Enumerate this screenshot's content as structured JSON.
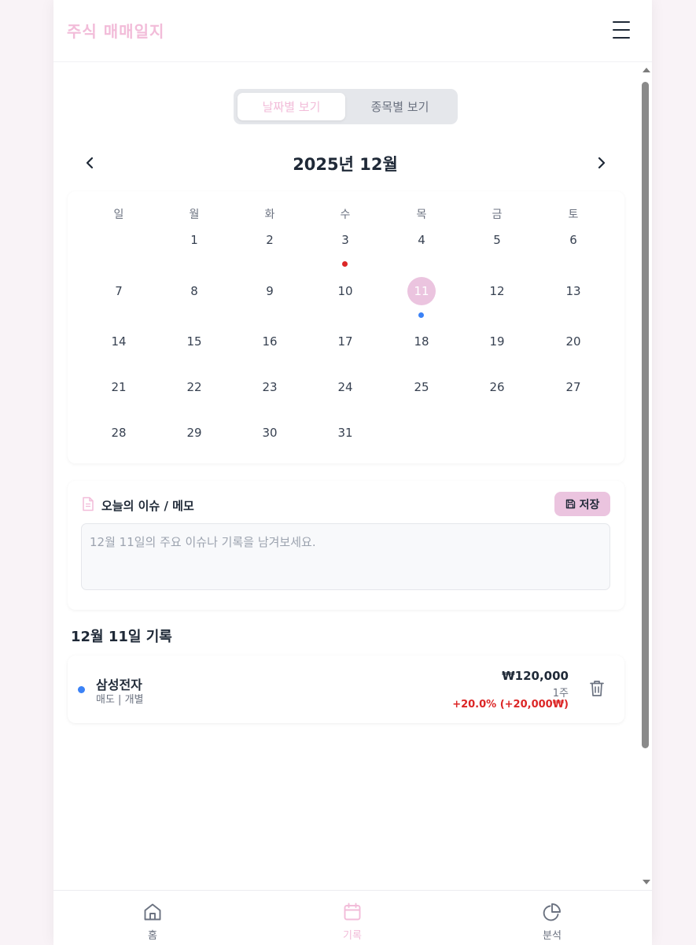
{
  "header": {
    "title": "주식 매매일지"
  },
  "view_toggle": {
    "by_date": "날짜별 보기",
    "by_stock": "종목별 보기",
    "selected": "by_date"
  },
  "calendar": {
    "month_title": "2025년 12월",
    "weekdays": [
      "일",
      "월",
      "화",
      "수",
      "목",
      "금",
      "토"
    ],
    "weeks": [
      [
        "",
        "1",
        "2",
        "3",
        "4",
        "5",
        "6"
      ],
      [
        "7",
        "8",
        "9",
        "10",
        "11",
        "12",
        "13"
      ],
      [
        "14",
        "15",
        "16",
        "17",
        "18",
        "19",
        "20"
      ],
      [
        "21",
        "22",
        "23",
        "24",
        "25",
        "26",
        "27"
      ],
      [
        "28",
        "29",
        "30",
        "31",
        "",
        "",
        ""
      ]
    ],
    "selected_day": "11",
    "day_markers": [
      {
        "day": "3",
        "color": "#dc2626"
      },
      {
        "day": "11",
        "color": "#3b82f6"
      }
    ]
  },
  "memo": {
    "title": "오늘의 이슈 / 메모",
    "save_label": "저장",
    "placeholder": "12월 11일의 주요 이슈나 기록을 남겨보세요.",
    "value": ""
  },
  "records": {
    "heading": "12월 11일 기록",
    "items": [
      {
        "name": "삼성전자",
        "type": "매도 | 개별",
        "amount": "₩120,000",
        "quantity": "1주",
        "profit": "+20.0% (+20,000₩)",
        "dot_color": "#3b82f6"
      }
    ]
  },
  "bottom_nav": {
    "items": [
      {
        "label": "홈",
        "icon": "home-icon",
        "active": false
      },
      {
        "label": "기록",
        "icon": "calendar-icon",
        "active": true
      },
      {
        "label": "분석",
        "icon": "pie-chart-icon",
        "active": false
      }
    ]
  },
  "colors": {
    "accent": "#f2bcd9",
    "accent_fill": "#ebc4df",
    "loss_dot": "#dc2626",
    "sell_dot": "#3b82f6",
    "profit_text": "#dc2626",
    "inactive_icon": "#6b7280"
  }
}
